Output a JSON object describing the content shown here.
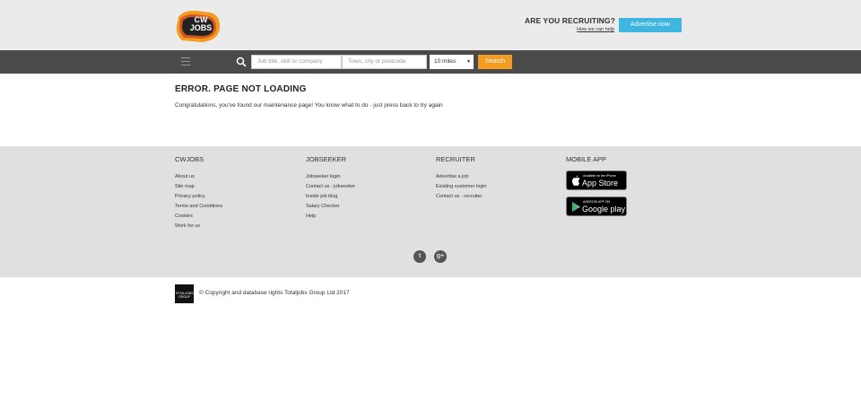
{
  "header": {
    "logo_text": "CW JOBS",
    "recruiting_title": "ARE YOU RECRUITING?",
    "how_we_can_help": "How we can help",
    "advertise_label": "Advertise now"
  },
  "search": {
    "job_placeholder": "Job title, skill or company",
    "location_placeholder": "Town, city or postcode",
    "radius_value": "10 miles",
    "search_label": "Search"
  },
  "main": {
    "error_title": "ERROR. PAGE NOT LOADING",
    "error_message": "Congratulations, you've found our maintenance page! You know what to do - just press back to try again"
  },
  "footer": {
    "columns": [
      {
        "title": "CWJOBS",
        "links": [
          "About us",
          "Site map",
          "Privacy policy",
          "Terms and Conditions",
          "Cookies",
          "Work for us"
        ]
      },
      {
        "title": "JOBSEEKER",
        "links": [
          "Jobseeker login",
          "Contact us - jobseeker",
          "Inside job blog",
          "Salary Checker",
          "Help"
        ]
      },
      {
        "title": "RECRUITER",
        "links": [
          "Advertise a job",
          "Existing customer login",
          "Contact us - recruiter"
        ]
      },
      {
        "title": "MOBILE APP"
      }
    ],
    "app_store": {
      "small": "Available on the iPhone",
      "big": "App Store"
    },
    "google_play": {
      "small": "ANDROID APP ON",
      "big": "Google play"
    },
    "social": {
      "twitter": "t",
      "googleplus": "g+"
    }
  },
  "bottom": {
    "group_logo_text": "TOTALJOBS GROUP",
    "copyright": "© Copyright and database rights Totaljobs Group Ltd 2017"
  },
  "colors": {
    "accent_orange": "#f39c1f",
    "accent_blue": "#3fb6e0",
    "nav_dark": "#4a4a4a"
  }
}
